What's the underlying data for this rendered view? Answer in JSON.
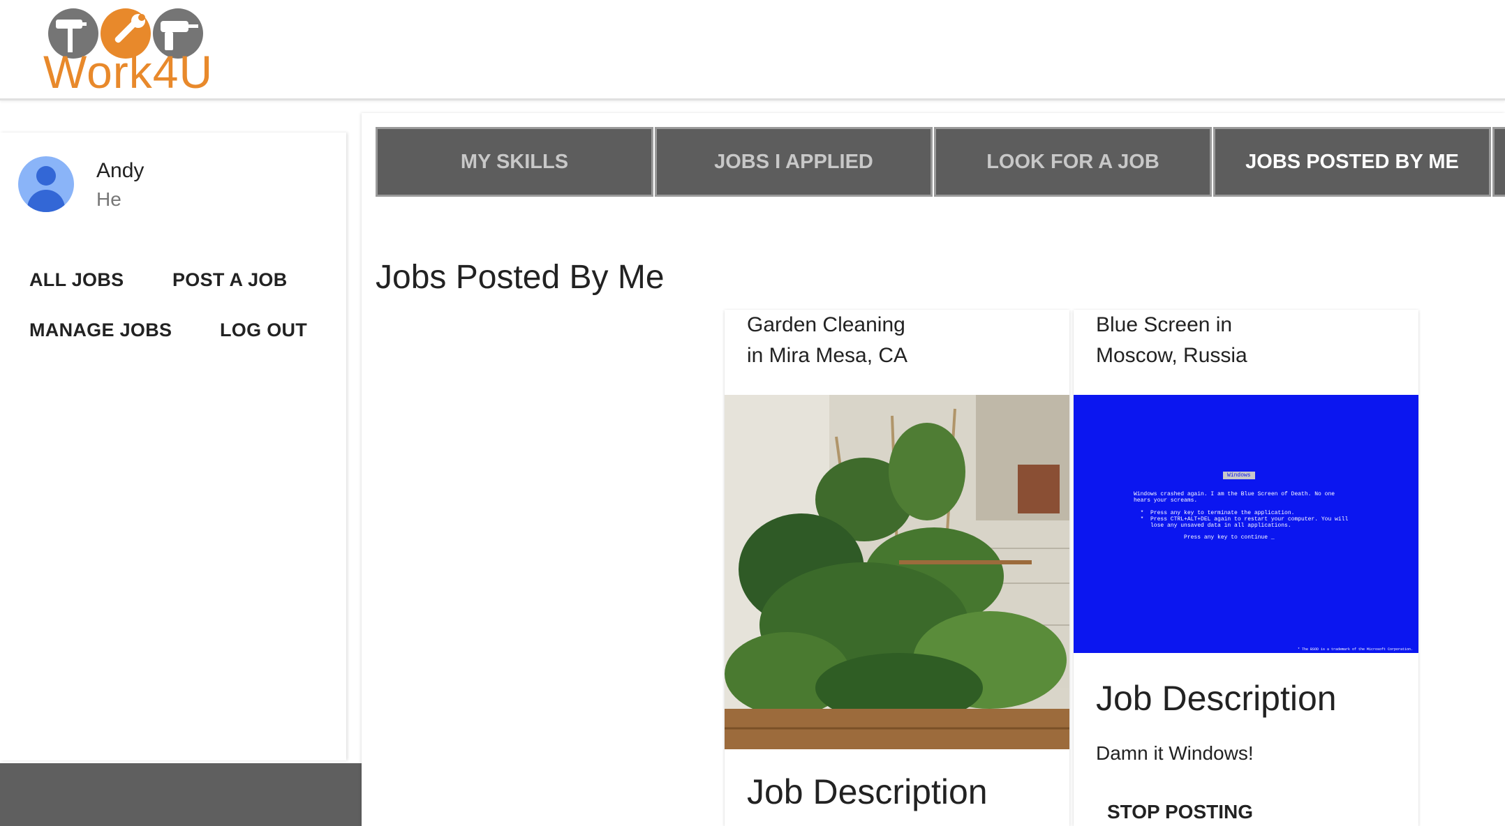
{
  "brand": {
    "name": "Work4U",
    "accent": "#e8892b",
    "gear_gray": "#757575"
  },
  "user": {
    "name": "Andy",
    "subtitle": "He"
  },
  "sidebar": {
    "links": [
      "ALL JOBS",
      "POST A JOB",
      "MANAGE JOBS",
      "LOG OUT"
    ]
  },
  "tabs": [
    {
      "label": "MY SKILLS",
      "active": false
    },
    {
      "label": "JOBS I APPLIED",
      "active": false
    },
    {
      "label": "LOOK FOR A JOB",
      "active": false
    },
    {
      "label": "JOBS POSTED BY ME",
      "active": true
    }
  ],
  "page": {
    "title": "Jobs Posted By Me"
  },
  "jobs": [
    {
      "title": "Garden Cleaning\nin Mira Mesa, CA",
      "image": "garden-photo",
      "description_title": "Job Description"
    },
    {
      "title": "Blue Screen in\nMoscow, Russia",
      "image": "blue-screen-photo",
      "description_title": "Job Description",
      "description": "Damn it Windows!",
      "action": "STOP POSTING"
    }
  ],
  "bsod": {
    "label": "Windows",
    "lines": [
      "Windows crashed again. I am the Blue Screen of Death. No one",
      "hears your screams.",
      "",
      "  *  Press any key to terminate the application.",
      "  *  Press CTRL+ALT+DEL again to restart your computer. You will",
      "     lose any unsaved data in all applications.",
      "",
      "               Press any key to continue _"
    ],
    "footer": "* The BSOD is a trademark of the Microsoft Corporation.",
    "color": "#0b16f0"
  }
}
